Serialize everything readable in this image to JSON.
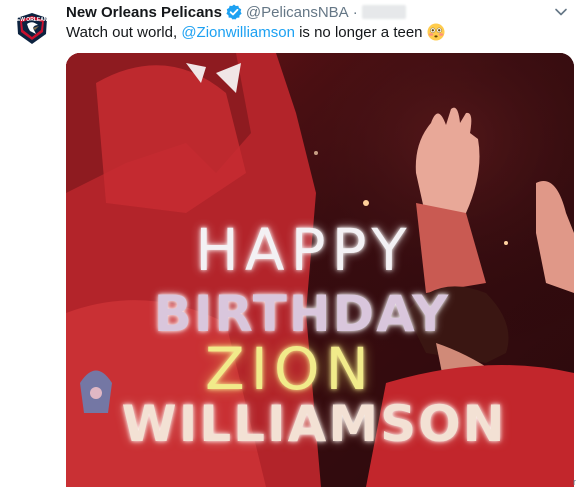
{
  "tweet": {
    "display_name": "New Orleans Pelicans",
    "handle": "@PelicansNBA",
    "separator": "·",
    "text_before": "Watch out world, ",
    "mention": "@Zionwilliamson",
    "text_after": " is no longer a teen",
    "emoji_icon": "flushed-face-emoji",
    "verified_icon": "verified-badge-icon",
    "caret_icon": "chevron-down-icon"
  },
  "avatar": {
    "logo_text": "NEW ORLEANS"
  },
  "media": {
    "line1": "HAPPY",
    "line2": "BIRTHDAY",
    "line3": "ZION",
    "line4": "WILLIAMSON"
  },
  "colors": {
    "link": "#1da1f2",
    "secondary_text": "#657786",
    "primary_text": "#14171a",
    "pelicans_navy": "#0c2340",
    "pelicans_red": "#c8102e",
    "pelicans_gold": "#85714d"
  },
  "corner_mark": "r"
}
